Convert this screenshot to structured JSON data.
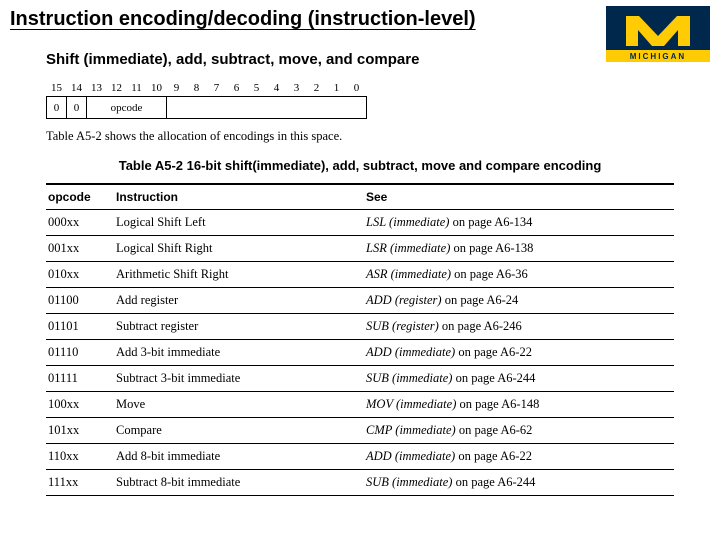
{
  "title": "Instruction encoding/decoding (instruction-level)",
  "logo": {
    "alt": "University of Michigan block-M logo",
    "blue": "#00274c",
    "maize": "#ffcb05"
  },
  "subheading": "Shift (immediate), add, subtract, move, and compare",
  "bit_header": [
    "15",
    "14",
    "13",
    "12",
    "11",
    "10",
    "9",
    "8",
    "7",
    "6",
    "5",
    "4",
    "3",
    "2",
    "1",
    "0"
  ],
  "bit_row": {
    "b15": "0",
    "b14": "0",
    "opcode": "opcode",
    "rest": ""
  },
  "caption": "Table A5-2 shows the allocation of encodings in this space.",
  "table_title": "Table A5-2 16-bit shift(immediate), add, subtract, move and compare encoding",
  "heads": {
    "opcode": "opcode",
    "instr": "Instruction",
    "see": "See"
  },
  "rows": [
    {
      "op": "000xx",
      "instr": "Logical Shift Left",
      "see_i": "LSL (immediate)",
      "see_t": " on page A6-134"
    },
    {
      "op": "001xx",
      "instr": "Logical Shift Right",
      "see_i": "LSR (immediate)",
      "see_t": " on page A6-138"
    },
    {
      "op": "010xx",
      "instr": "Arithmetic Shift Right",
      "see_i": "ASR (immediate)",
      "see_t": " on page A6-36"
    },
    {
      "op": "01100",
      "instr": "Add register",
      "see_i": "ADD (register)",
      "see_t": " on page A6-24"
    },
    {
      "op": "01101",
      "instr": "Subtract register",
      "see_i": "SUB (register)",
      "see_t": " on page A6-246"
    },
    {
      "op": "01110",
      "instr": "Add 3-bit immediate",
      "see_i": "ADD (immediate)",
      "see_t": " on page A6-22"
    },
    {
      "op": "01111",
      "instr": "Subtract 3-bit immediate",
      "see_i": "SUB (immediate)",
      "see_t": " on page A6-244"
    },
    {
      "op": "100xx",
      "instr": "Move",
      "see_i": "MOV (immediate)",
      "see_t": " on page A6-148"
    },
    {
      "op": "101xx",
      "instr": "Compare",
      "see_i": "CMP (immediate)",
      "see_t": " on page A6-62"
    },
    {
      "op": "110xx",
      "instr": "Add 8-bit immediate",
      "see_i": "ADD (immediate)",
      "see_t": " on page A6-22"
    },
    {
      "op": "111xx",
      "instr": "Subtract 8-bit immediate",
      "see_i": "SUB (immediate)",
      "see_t": " on page A6-244"
    }
  ]
}
